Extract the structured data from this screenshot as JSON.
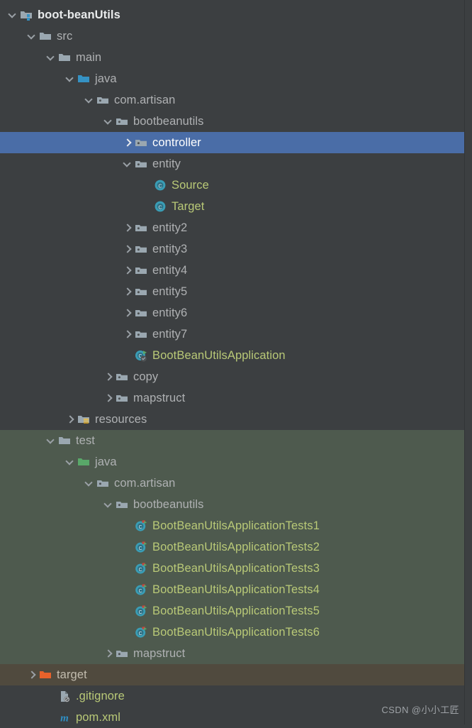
{
  "panel": {
    "name": "project-tree",
    "background": "#3C3F41",
    "selection_color": "#4A6DA7",
    "test_scope_color": "#4E5A4E",
    "excluded_scope_color": "#504A3E",
    "folder_text_color": "#AFB1B3",
    "class_text_color": "#B9C977"
  },
  "watermark": "CSDN @小小工匠",
  "rows": [
    {
      "label": "boot-beanUtils",
      "icon": "module-folder-icon",
      "arrow": "down",
      "depth": 0,
      "style": "root",
      "bg": "none",
      "selected": false
    },
    {
      "label": "src",
      "icon": "folder-icon",
      "arrow": "down",
      "depth": 1,
      "style": "folder",
      "bg": "none",
      "selected": false
    },
    {
      "label": "main",
      "icon": "folder-icon",
      "arrow": "down",
      "depth": 2,
      "style": "folder",
      "bg": "none",
      "selected": false
    },
    {
      "label": "java",
      "icon": "source-root-folder-icon",
      "arrow": "down",
      "depth": 3,
      "style": "folder",
      "bg": "none",
      "selected": false
    },
    {
      "label": "com.artisan",
      "icon": "package-folder-icon",
      "arrow": "down",
      "depth": 4,
      "style": "folder",
      "bg": "none",
      "selected": false
    },
    {
      "label": "bootbeanutils",
      "icon": "package-folder-icon",
      "arrow": "down",
      "depth": 5,
      "style": "folder",
      "bg": "none",
      "selected": false
    },
    {
      "label": "controller",
      "icon": "package-folder-icon",
      "arrow": "right",
      "depth": 6,
      "style": "folder",
      "bg": "none",
      "selected": true
    },
    {
      "label": "entity",
      "icon": "package-folder-icon",
      "arrow": "down",
      "depth": 6,
      "style": "folder",
      "bg": "none",
      "selected": false
    },
    {
      "label": "Source",
      "icon": "java-class-icon",
      "arrow": "none",
      "depth": 7,
      "style": "class",
      "bg": "none",
      "selected": false
    },
    {
      "label": "Target",
      "icon": "java-class-icon",
      "arrow": "none",
      "depth": 7,
      "style": "class",
      "bg": "none",
      "selected": false
    },
    {
      "label": "entity2",
      "icon": "package-folder-icon",
      "arrow": "right",
      "depth": 6,
      "style": "folder",
      "bg": "none",
      "selected": false
    },
    {
      "label": "entity3",
      "icon": "package-folder-icon",
      "arrow": "right",
      "depth": 6,
      "style": "folder",
      "bg": "none",
      "selected": false
    },
    {
      "label": "entity4",
      "icon": "package-folder-icon",
      "arrow": "right",
      "depth": 6,
      "style": "folder",
      "bg": "none",
      "selected": false
    },
    {
      "label": "entity5",
      "icon": "package-folder-icon",
      "arrow": "right",
      "depth": 6,
      "style": "folder",
      "bg": "none",
      "selected": false
    },
    {
      "label": "entity6",
      "icon": "package-folder-icon",
      "arrow": "right",
      "depth": 6,
      "style": "folder",
      "bg": "none",
      "selected": false
    },
    {
      "label": "entity7",
      "icon": "package-folder-icon",
      "arrow": "right",
      "depth": 6,
      "style": "folder",
      "bg": "none",
      "selected": false
    },
    {
      "label": "BootBeanUtilsApplication",
      "icon": "runnable-class-icon",
      "arrow": "none",
      "depth": 6,
      "style": "class",
      "bg": "none",
      "selected": false
    },
    {
      "label": "copy",
      "icon": "package-folder-icon",
      "arrow": "right",
      "depth": 5,
      "style": "folder",
      "bg": "none",
      "selected": false
    },
    {
      "label": "mapstruct",
      "icon": "package-folder-icon",
      "arrow": "right",
      "depth": 5,
      "style": "folder",
      "bg": "none",
      "selected": false
    },
    {
      "label": "resources",
      "icon": "resources-folder-icon",
      "arrow": "right",
      "depth": 3,
      "style": "folder",
      "bg": "none",
      "selected": false
    },
    {
      "label": "test",
      "icon": "folder-icon",
      "arrow": "down",
      "depth": 2,
      "style": "folder",
      "bg": "test",
      "selected": false
    },
    {
      "label": "java",
      "icon": "test-root-folder-icon",
      "arrow": "down",
      "depth": 3,
      "style": "folder",
      "bg": "test",
      "selected": false
    },
    {
      "label": "com.artisan",
      "icon": "package-folder-icon",
      "arrow": "down",
      "depth": 4,
      "style": "folder",
      "bg": "test",
      "selected": false
    },
    {
      "label": "bootbeanutils",
      "icon": "package-folder-icon",
      "arrow": "down",
      "depth": 5,
      "style": "folder",
      "bg": "test",
      "selected": false
    },
    {
      "label": "BootBeanUtilsApplicationTests1",
      "icon": "test-class-icon",
      "arrow": "none",
      "depth": 6,
      "style": "class",
      "bg": "test",
      "selected": false
    },
    {
      "label": "BootBeanUtilsApplicationTests2",
      "icon": "test-class-icon",
      "arrow": "none",
      "depth": 6,
      "style": "class",
      "bg": "test",
      "selected": false
    },
    {
      "label": "BootBeanUtilsApplicationTests3",
      "icon": "test-class-icon",
      "arrow": "none",
      "depth": 6,
      "style": "class",
      "bg": "test",
      "selected": false
    },
    {
      "label": "BootBeanUtilsApplicationTests4",
      "icon": "test-class-icon",
      "arrow": "none",
      "depth": 6,
      "style": "class",
      "bg": "test",
      "selected": false
    },
    {
      "label": "BootBeanUtilsApplicationTests5",
      "icon": "test-class-icon",
      "arrow": "none",
      "depth": 6,
      "style": "class",
      "bg": "test",
      "selected": false
    },
    {
      "label": "BootBeanUtilsApplicationTests6",
      "icon": "test-class-icon",
      "arrow": "none",
      "depth": 6,
      "style": "class",
      "bg": "test",
      "selected": false
    },
    {
      "label": "mapstruct",
      "icon": "package-folder-icon",
      "arrow": "right",
      "depth": 5,
      "style": "folder",
      "bg": "test",
      "selected": false
    },
    {
      "label": "target",
      "icon": "excluded-folder-icon",
      "arrow": "right",
      "depth": 1,
      "style": "target",
      "bg": "target",
      "selected": false
    },
    {
      "label": ".gitignore",
      "icon": "gitignore-file-icon",
      "arrow": "none",
      "depth": 2,
      "style": "class",
      "bg": "none",
      "selected": false
    },
    {
      "label": "pom.xml",
      "icon": "maven-pom-icon",
      "arrow": "none",
      "depth": 2,
      "style": "class",
      "bg": "none",
      "selected": false
    }
  ]
}
